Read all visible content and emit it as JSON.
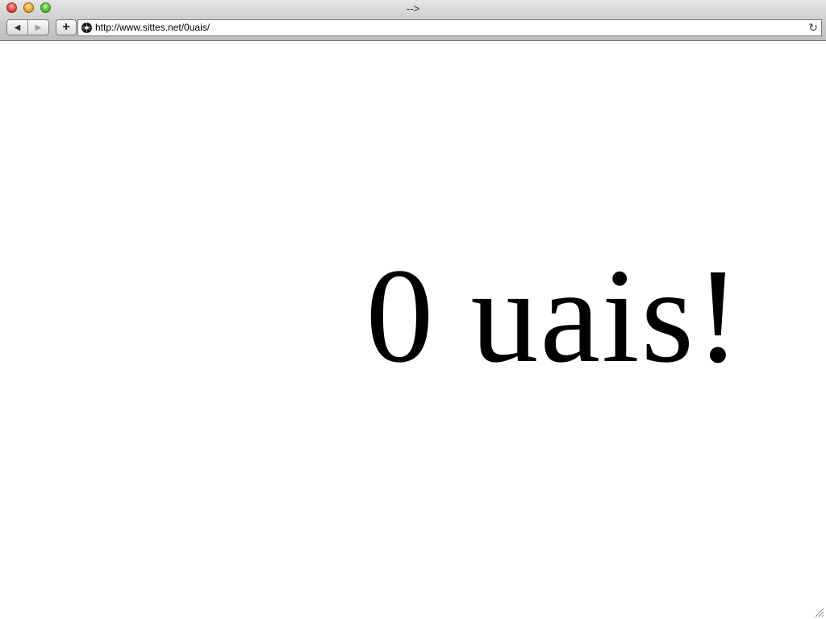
{
  "window": {
    "title": "-->"
  },
  "toolbar": {
    "back_icon": "back-arrow-icon",
    "back_label": "◀",
    "forward_icon": "forward-arrow-icon",
    "forward_label": "▶",
    "add_icon": "plus-icon",
    "add_label": "+",
    "reload_icon": "reload-icon",
    "reload_label": "↻"
  },
  "address": {
    "url": "http://www.sittes.net/0uais/",
    "favicon": "site-favicon-icon"
  },
  "page": {
    "headline": "0 uais!"
  }
}
